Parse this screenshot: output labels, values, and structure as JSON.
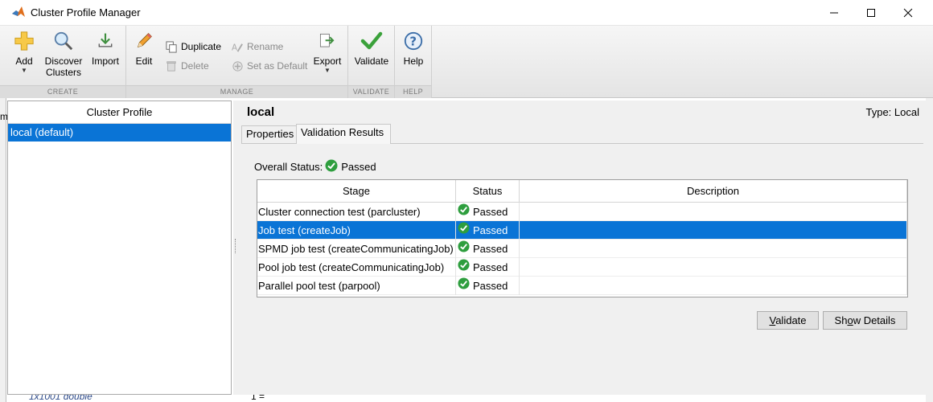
{
  "window": {
    "title": "Cluster Profile Manager"
  },
  "toolstrip": {
    "create": {
      "label": "CREATE",
      "add": "Add",
      "discover_line1": "Discover",
      "discover_line2": "Clusters",
      "import": "Import"
    },
    "manage": {
      "label": "MANAGE",
      "edit": "Edit",
      "duplicate": "Duplicate",
      "delete": "Delete",
      "rename": "Rename",
      "set_default": "Set as Default",
      "export": "Export"
    },
    "validate": {
      "label": "VALIDATE",
      "validate": "Validate"
    },
    "help": {
      "label": "HELP",
      "help": "Help"
    }
  },
  "background": {
    "letter": "m",
    "bottom_left_text": "1x1001 double",
    "bottom_right_text": "1 ="
  },
  "profiles": {
    "header": "Cluster Profile",
    "items": [
      {
        "label": "local (default)",
        "selected": true
      }
    ]
  },
  "detail": {
    "name": "local",
    "type": "Type: Local",
    "tabs": [
      {
        "label": "Properties",
        "active": false
      },
      {
        "label": "Validation Results",
        "active": true
      }
    ],
    "overall_label": "Overall Status:",
    "overall_value": "Passed",
    "table": {
      "columns": [
        "Stage",
        "Status",
        "Description"
      ],
      "rows": [
        {
          "stage": "Cluster connection test (parcluster)",
          "status": "Passed",
          "description": "",
          "selected": false
        },
        {
          "stage": "Job test (createJob)",
          "status": "Passed",
          "description": "",
          "selected": true
        },
        {
          "stage": "SPMD job test (createCommunicatingJob)",
          "status": "Passed",
          "description": "",
          "selected": false
        },
        {
          "stage": "Pool job test (createCommunicatingJob)",
          "status": "Passed",
          "description": "",
          "selected": false
        },
        {
          "stage": "Parallel pool test (parpool)",
          "status": "Passed",
          "description": "",
          "selected": false
        }
      ]
    },
    "buttons": {
      "validate_first": "V",
      "validate_rest": "alidate",
      "details_first": "Sh",
      "details_mnemonic": "o",
      "details_rest": "w Details"
    }
  },
  "colors": {
    "selection": "#0a74d6",
    "passed": "#2e9e3e"
  }
}
